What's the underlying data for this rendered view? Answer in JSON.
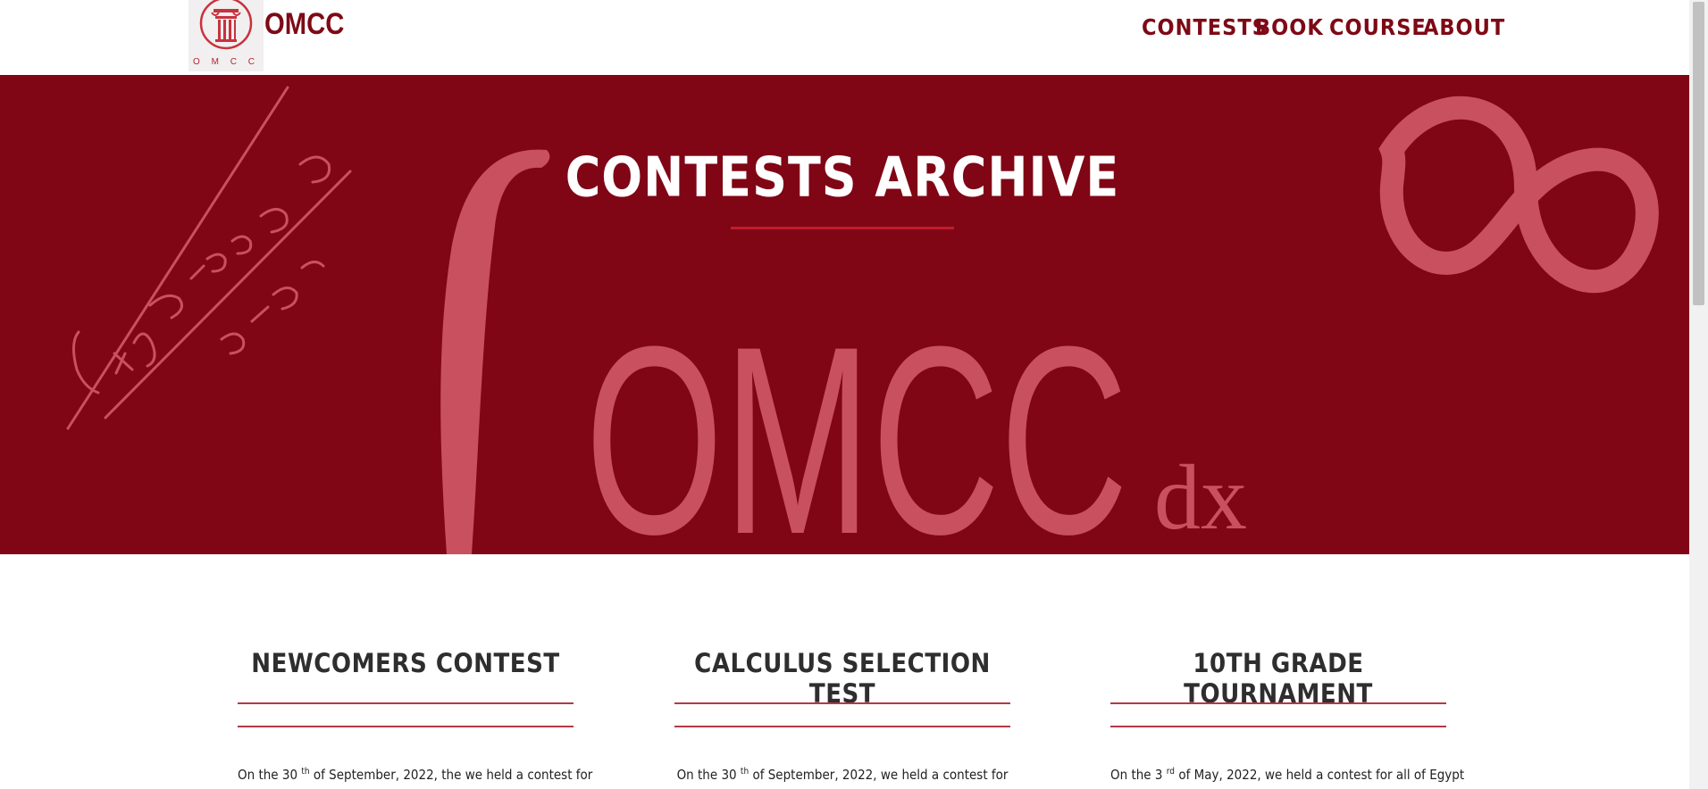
{
  "brand": {
    "name": "OMCC",
    "logo_caption": "O M C C"
  },
  "nav": {
    "items": [
      "CONTESTS",
      "BOOK",
      "COURSE",
      "ABOUT"
    ]
  },
  "hero": {
    "title": "CONTESTS ARCHIVE",
    "watermark": {
      "text": "OMCC",
      "suffix": "dx"
    }
  },
  "cards": [
    {
      "title": "NEWCOMERS CONTEST",
      "text_pre": "On the 30",
      "text_sup": "th",
      "text_post": "of September, 2022, the we held a contest for"
    },
    {
      "title": "CALCULUS SELECTION TEST",
      "text_pre": "On the 30",
      "text_sup": "th",
      "text_post": "of September, 2022, we held a contest for"
    },
    {
      "title": "10TH GRADE TOURNAMENT",
      "text_pre": "On the 3",
      "text_sup": "rd",
      "text_post": "of May, 2022, we held a contest for all of Egypt"
    }
  ],
  "colors": {
    "brand": "#7e0916",
    "hero_bg": "#800615",
    "hero_motif": "#c9505f",
    "accent_line": "#c11d2c"
  }
}
